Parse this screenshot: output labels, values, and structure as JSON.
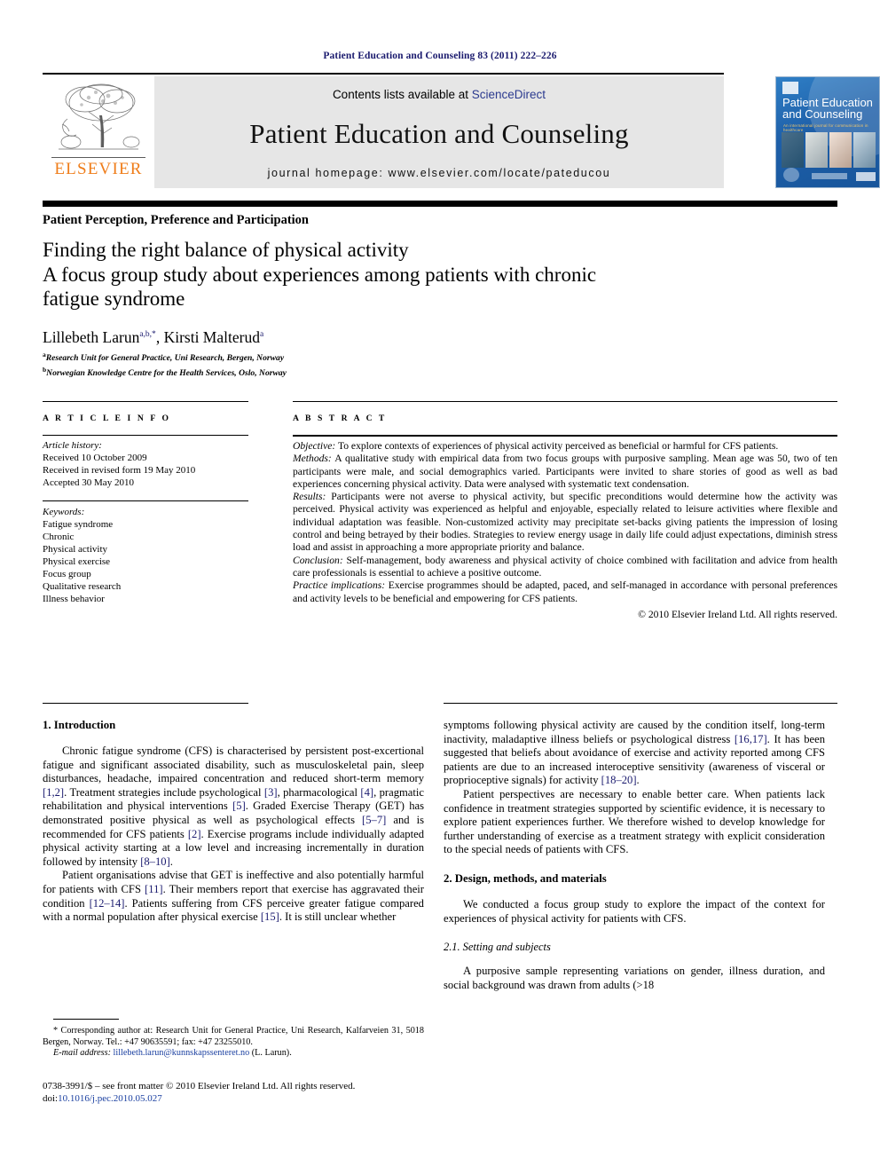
{
  "running_head": "Patient Education and Counseling 83 (2011) 222–226",
  "masthead": {
    "contents_prefix": "Contents lists available at ",
    "sciencedirect": "ScienceDirect",
    "journal_title": "Patient Education and Counseling",
    "homepage": "journal homepage: www.elsevier.com/locate/pateducou",
    "publisher_logo_word": "ELSEVIER",
    "cover": {
      "title": "Patient Education and Counseling",
      "subtitle": "An international journal for communication in healthcare"
    }
  },
  "section_kicker": "Patient Perception, Preference and Participation",
  "title": {
    "main": "Finding the right balance of physical activity",
    "subtitle_line1": "A focus group study about experiences among patients with chronic",
    "subtitle_line2": "fatigue syndrome"
  },
  "authors": {
    "author1": "Lillebeth Larun",
    "author1_sup": "a,b,*",
    "separator": ", ",
    "author2": "Kirsti Malterud",
    "author2_sup": "a",
    "affiliation_a_sup": "a",
    "affiliation_a": "Research Unit for General Practice, Uni Research, Bergen, Norway",
    "affiliation_b_sup": "b",
    "affiliation_b": "Norwegian Knowledge Centre for the Health Services, Oslo, Norway"
  },
  "headings": {
    "article_info": "A R T I C L E   I N F O",
    "abstract": "A B S T R A C T"
  },
  "article_history": {
    "label": "Article history:",
    "received": "Received 10 October 2009",
    "revised": "Received in revised form 19 May 2010",
    "accepted": "Accepted 30 May 2010"
  },
  "keywords": {
    "label": "Keywords:",
    "items": [
      "Fatigue syndrome",
      "Chronic",
      "Physical activity",
      "Physical exercise",
      "Focus group",
      "Qualitative research",
      "Illness behavior"
    ]
  },
  "abstract": {
    "objective_label": "Objective:",
    "objective_text": " To explore contexts of experiences of physical activity perceived as beneficial or harmful for CFS patients.",
    "methods_label": "Methods:",
    "methods_text": " A qualitative study with empirical data from two focus groups with purposive sampling. Mean age was 50, two of ten participants were male, and social demographics varied. Participants were invited to share stories of good as well as bad experiences concerning physical activity. Data were analysed with systematic text condensation.",
    "results_label": "Results:",
    "results_text": " Participants were not averse to physical activity, but specific preconditions would determine how the activity was perceived. Physical activity was experienced as helpful and enjoyable, especially related to leisure activities where flexible and individual adaptation was feasible. Non-customized activity may precipitate set-backs giving patients the impression of losing control and being betrayed by their bodies. Strategies to review energy usage in daily life could adjust expectations, diminish stress load and assist in approaching a more appropriate priority and balance.",
    "conclusion_label": "Conclusion:",
    "conclusion_text": " Self-management, body awareness and physical activity of choice combined with facilitation and advice from health care professionals is essential to achieve a positive outcome.",
    "practice_label": "Practice implications:",
    "practice_text": " Exercise programmes should be adapted, paced, and self-managed in accordance with personal preferences and activity levels to be beneficial and empowering for CFS patients.",
    "copyright": "© 2010 Elsevier Ireland Ltd. All rights reserved."
  },
  "body": {
    "left": {
      "h1_intro": "1. Introduction",
      "p1_a": "Chronic fatigue syndrome (CFS) is characterised by persistent post-excertional fatigue and significant associated disability, such as musculoskeletal pain, sleep disturbances, headache, impaired concentration and reduced short-term memory ",
      "p1_r1": "[1,2]",
      "p1_b": ". Treatment strategies include psychological ",
      "p1_r2": "[3]",
      "p1_c": ", pharmacological ",
      "p1_r3": "[4]",
      "p1_d": ", pragmatic rehabilitation and physical interventions ",
      "p1_r4": "[5]",
      "p1_e": ". Graded Exercise Therapy (GET) has demonstrated positive physical as well as psychological effects ",
      "p1_r5": "[5–7]",
      "p1_f": " and is recommended for CFS patients ",
      "p1_r6": "[2]",
      "p1_g": ". Exercise programs include individually adapted physical activity starting at a low level and increasing incrementally in duration followed by intensity ",
      "p1_r7": "[8–10]",
      "p1_h": ".",
      "p2_a": "Patient organisations advise that GET is ineffective and also potentially harmful for patients with CFS ",
      "p2_r1": "[11]",
      "p2_b": ". Their members report that exercise has aggravated their condition ",
      "p2_r2": "[12–14]",
      "p2_c": ". Patients suffering from CFS perceive greater fatigue compared with a normal population after physical exercise ",
      "p2_r3": "[15]",
      "p2_d": ". It is still unclear whether"
    },
    "right": {
      "p3_a": "symptoms following physical activity are caused by the condition itself, long-term inactivity, maladaptive illness beliefs or psychological distress ",
      "p3_r1": "[16,17]",
      "p3_b": ". It has been suggested that beliefs about avoidance of exercise and activity reported among CFS patients are due to an increased interoceptive sensitivity (awareness of visceral or proprioceptive signals) for activity ",
      "p3_r2": "[18–20]",
      "p3_c": ".",
      "p4": "Patient perspectives are necessary to enable better care. When patients lack confidence in treatment strategies supported by scientific evidence, it is necessary to explore patient experiences further. We therefore wished to develop knowledge for further understanding of exercise as a treatment strategy with explicit consideration to the special needs of patients with CFS.",
      "h2_design": "2. Design, methods, and materials",
      "p5": "We conducted a focus group study to explore the impact of the context for experiences of physical activity for patients with CFS.",
      "h3_setting": "2.1. Setting and subjects",
      "p6": "A purposive sample representing variations on gender, illness duration, and social background was drawn from adults (>18"
    }
  },
  "footnote": {
    "star": "*",
    "corresponding_text": " Corresponding author at: Research Unit for General Practice, Uni Research, Kalfarveien 31, 5018 Bergen, Norway. Tel.: +47 90635591; fax: +47 23255010.",
    "email_label": "E-mail address:",
    "email": " lillebeth.larun@kunnskapssenteret.no",
    "email_suffix": " (L. Larun)."
  },
  "imprint": {
    "line1": "0738-3991/$ – see front matter © 2010 Elsevier Ireland Ltd. All rights reserved.",
    "doi_prefix": "doi:",
    "doi": "10.1016/j.pec.2010.05.027"
  }
}
